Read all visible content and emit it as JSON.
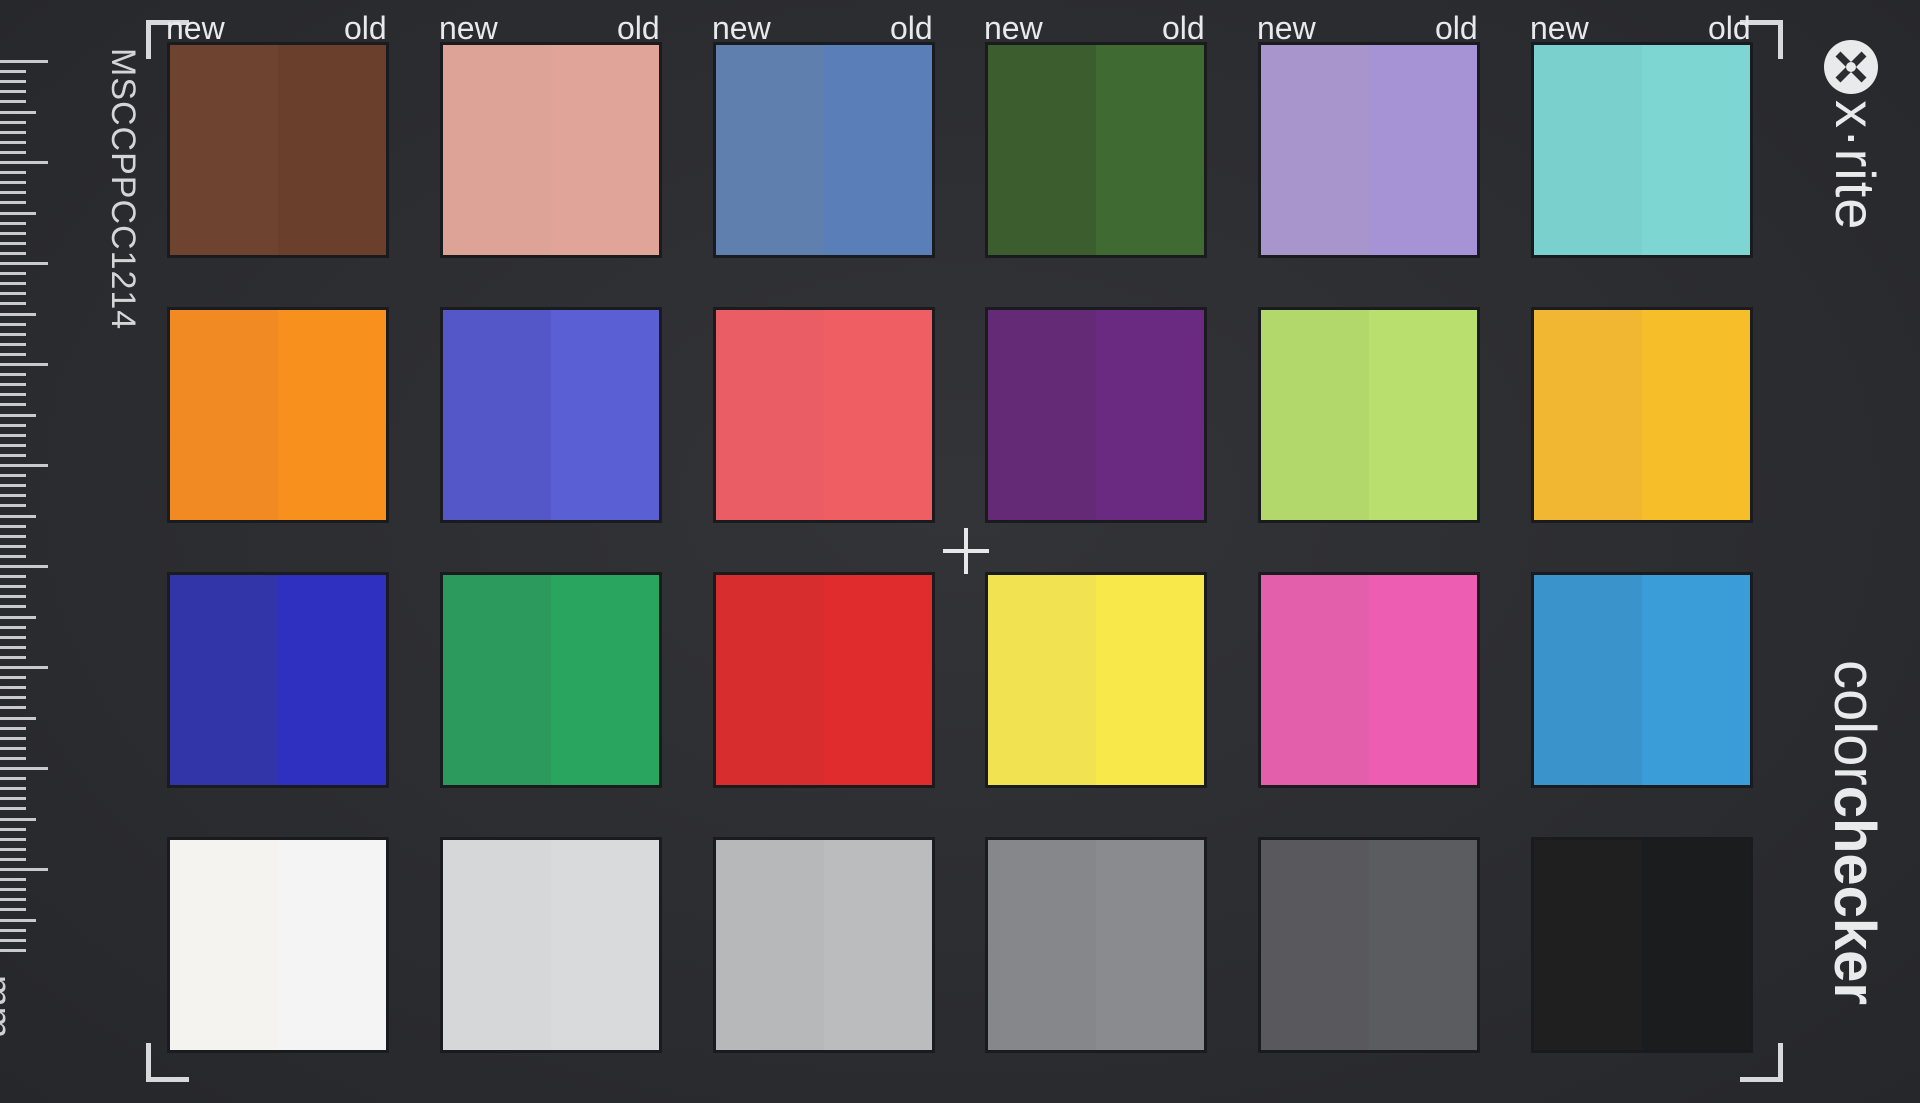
{
  "card": {
    "serial": "MSCCPPCC1214",
    "ruler_unit": "mm",
    "brand_icon": "x-rite-logo-icon",
    "brand": "x·rite",
    "product_light": "color",
    "product_bold": "checker"
  },
  "column_labels": [
    {
      "new": "new",
      "old": "old"
    },
    {
      "new": "new",
      "old": "old"
    },
    {
      "new": "new",
      "old": "old"
    },
    {
      "new": "new",
      "old": "old"
    },
    {
      "new": "new",
      "old": "old"
    },
    {
      "new": "new",
      "old": "old"
    }
  ],
  "patches": [
    [
      {
        "new": "#6e4430",
        "old": "#6a3f2c"
      },
      {
        "new": "#dea397",
        "old": "#e0a598"
      },
      {
        "new": "#5f7fae",
        "old": "#5a7fb8"
      },
      {
        "new": "#3c5e2f",
        "old": "#3f6b33"
      },
      {
        "new": "#a895cc",
        "old": "#a693d6"
      },
      {
        "new": "#79d0cc",
        "old": "#7ed6d2"
      }
    ],
    [
      {
        "new": "#f28a23",
        "old": "#f8901d"
      },
      {
        "new": "#5457c8",
        "old": "#5a5fd3"
      },
      {
        "new": "#ea5d64",
        "old": "#ef5e63"
      },
      {
        "new": "#642a75",
        "old": "#6b2a81"
      },
      {
        "new": "#b2d86c",
        "old": "#b9df6e"
      },
      {
        "new": "#f1b632",
        "old": "#f6bf2a"
      }
    ],
    [
      {
        "new": "#3135a8",
        "old": "#2f2fc0"
      },
      {
        "new": "#2b9a5c",
        "old": "#2aa55f"
      },
      {
        "new": "#d82d2f",
        "old": "#e12c2d"
      },
      {
        "new": "#f1e252",
        "old": "#f8e84a"
      },
      {
        "new": "#e35fab",
        "old": "#ed5db2"
      },
      {
        "new": "#3b93cb",
        "old": "#3a9dd8"
      }
    ],
    [
      {
        "new": "#f4f3ef",
        "old": "#f4f4f4"
      },
      {
        "new": "#d6d7d8",
        "old": "#d9dadb"
      },
      {
        "new": "#b6b8b9",
        "old": "#babcbd"
      },
      {
        "new": "#86878a",
        "old": "#8a8b8e"
      },
      {
        "new": "#59595d",
        "old": "#5b5c60"
      },
      {
        "new": "#1f1f20",
        "old": "#1b1c1e"
      }
    ]
  ]
}
